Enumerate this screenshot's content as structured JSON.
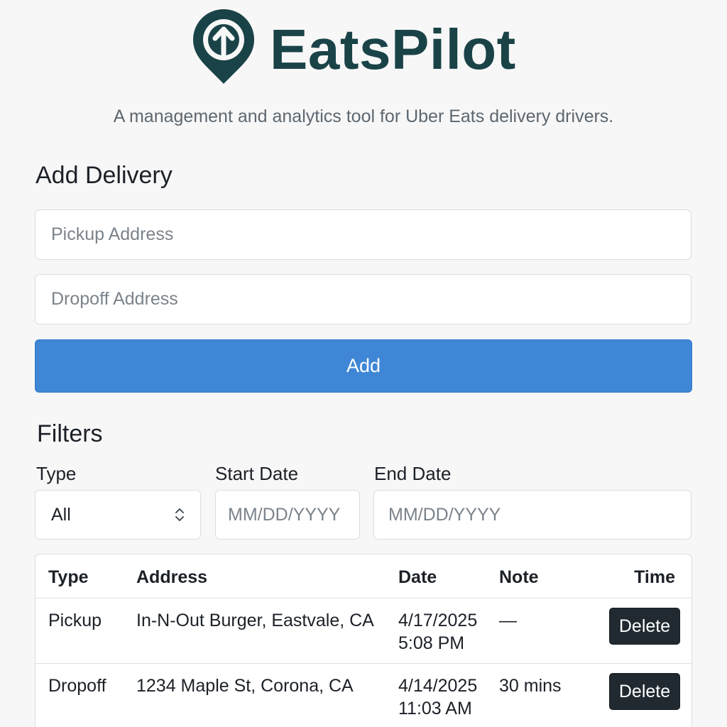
{
  "brand": {
    "name": "EatsPilot",
    "tagline": "A management and analytics tool for Uber Eats delivery drivers.",
    "color": "#1a4348"
  },
  "add_delivery": {
    "title": "Add Delivery",
    "pickup_placeholder": "Pickup Address",
    "dropoff_placeholder": "Dropoff Address",
    "add_label": "Add",
    "accent": "#3f87d6"
  },
  "filters": {
    "title": "Filters",
    "type_label": "Type",
    "type_value": "All",
    "start_label": "Start Date",
    "start_placeholder": "MM/DD/YYYY",
    "end_label": "End Date",
    "end_placeholder": "MM/DD/YYYY"
  },
  "table": {
    "headers": [
      "Type",
      "Address",
      "Date",
      "Note",
      "Time"
    ],
    "rows": [
      {
        "type": "Pickup",
        "address": "In-N-Out Burger, Eastvale, CA",
        "date": "4/17/2025",
        "time": "5:08 PM",
        "note": "—",
        "action": "Delete"
      },
      {
        "type": "Dropoff",
        "address": "1234 Maple St, Corona, CA",
        "date": "4/14/2025",
        "time": "11:03 AM",
        "note": "30 mins",
        "action": "Delete"
      }
    ]
  },
  "icons": {
    "logo": "location-pin-arrow-up-icon",
    "select": "chevron-up-down-icon"
  }
}
